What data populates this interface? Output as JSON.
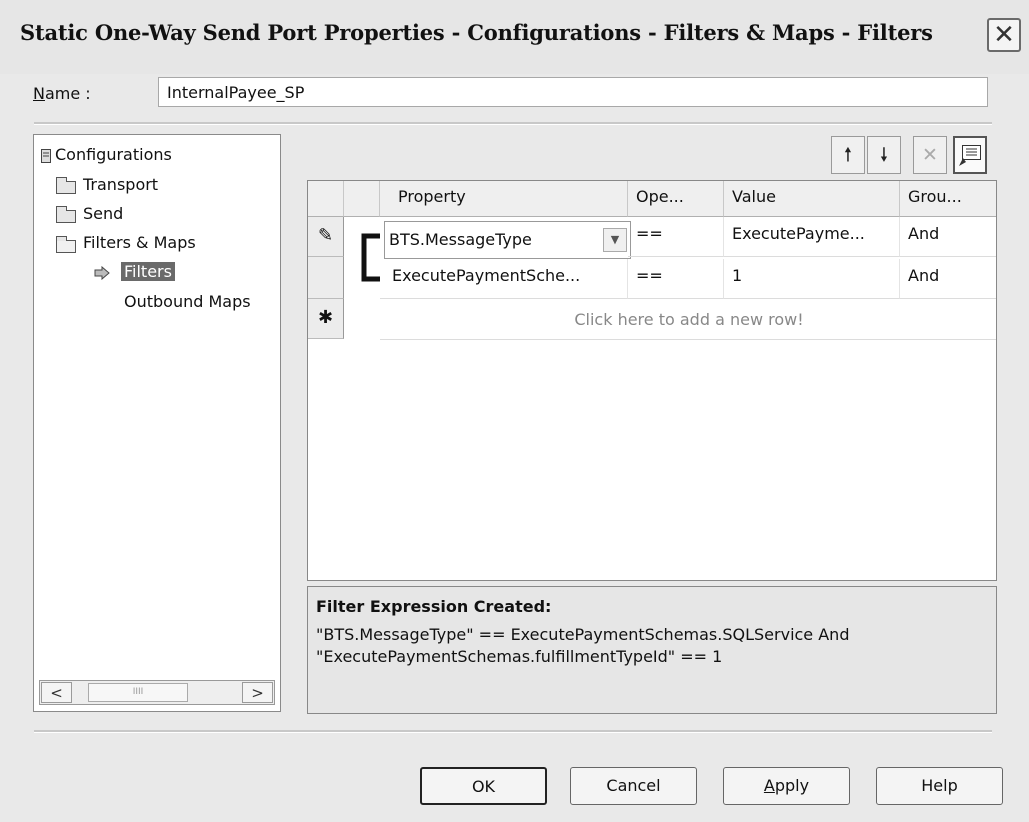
{
  "window": {
    "title": "Static One-Way Send Port Properties - Configurations - Filters & Maps - Filters",
    "close_glyph": "✕"
  },
  "name_field": {
    "label_prefix": "N",
    "label_rest": "ame :",
    "value": "InternalPayee_SP"
  },
  "tree": {
    "root": "Configurations",
    "items": [
      {
        "label": "Transport",
        "icon": "folder-icon"
      },
      {
        "label": "Send",
        "icon": "folder-icon"
      },
      {
        "label": "Filters & Maps",
        "icon": "folder-open-icon"
      }
    ],
    "children": [
      {
        "label": "Filters",
        "selected": true,
        "icon": "arrow-right-icon"
      },
      {
        "label": "Outbound Maps",
        "selected": false
      }
    ],
    "scroll_left": "<",
    "scroll_right": ">",
    "scroll_thumb": "IIII"
  },
  "toolbar": {
    "move_up": "🠕",
    "move_down": "🠗",
    "delete": "✕",
    "properties_icon": "grid-properties-icon"
  },
  "grid": {
    "columns": [
      "Property",
      "Ope...",
      "Value",
      "Grou..."
    ],
    "rows": [
      {
        "marker": "✎",
        "property": "BTS.MessageType",
        "operator": "==",
        "value": "ExecutePayme...",
        "group": "And"
      },
      {
        "marker": "",
        "property": "ExecutePaymentSche...",
        "operator": "==",
        "value": "1",
        "group": "And"
      }
    ],
    "new_row_marker": "✱",
    "new_row_text": "Click here to add a new row!"
  },
  "expression": {
    "title": "Filter Expression Created:",
    "line1": "\"BTS.MessageType\" == ExecutePaymentSchemas.SQLService And",
    "line2": "\"ExecutePaymentSchemas.fulfillmentTypeId\" == 1"
  },
  "buttons": {
    "ok": "OK",
    "cancel": "Cancel",
    "apply_prefix": "A",
    "apply_rest": "pply",
    "help": "Help"
  }
}
